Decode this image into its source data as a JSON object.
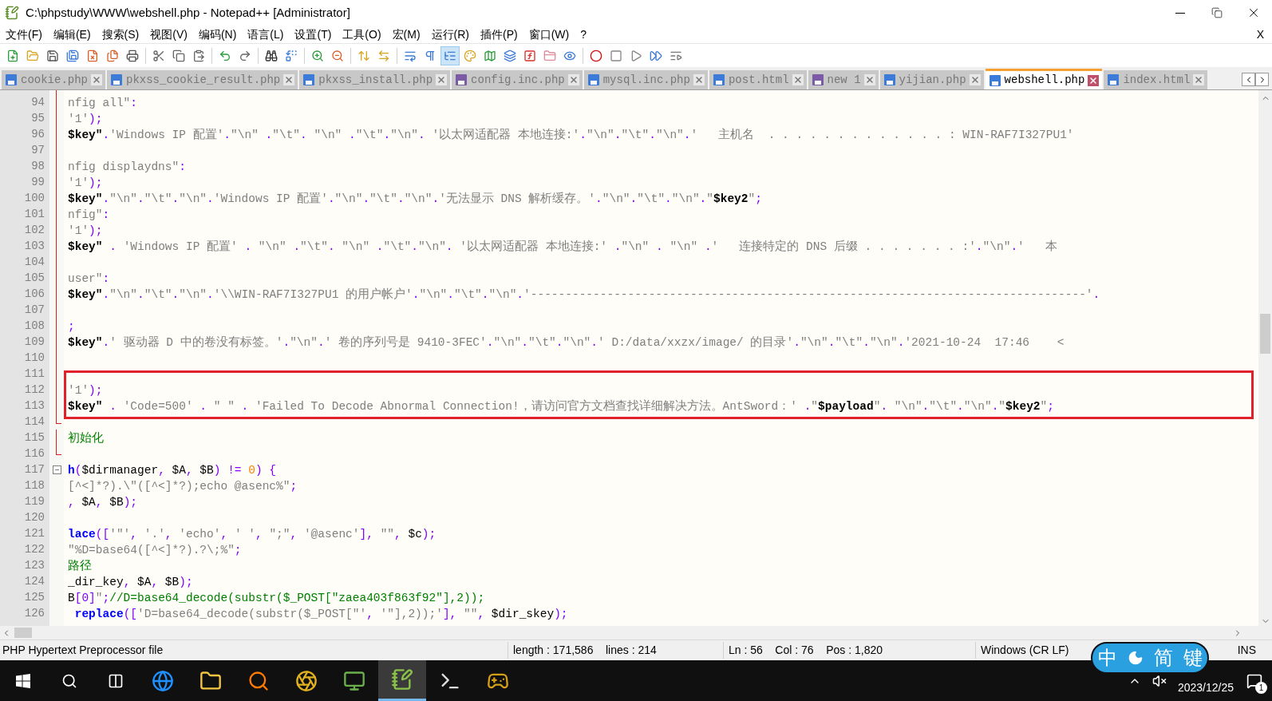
{
  "window": {
    "title": "C:\\phpstudy\\WWW\\webshell.php - Notepad++ [Administrator]"
  },
  "menu": [
    "文件(F)",
    "编辑(E)",
    "搜索(S)",
    "视图(V)",
    "编码(N)",
    "语言(L)",
    "设置(T)",
    "工具(O)",
    "宏(M)",
    "运行(R)",
    "插件(P)",
    "窗口(W)",
    "?"
  ],
  "menu_close": "X",
  "toolbar": [
    {
      "pressed": false
    },
    {
      "pressed": false
    },
    {
      "pressed": false
    },
    {
      "pressed": false
    },
    {
      "pressed": false
    },
    {
      "pressed": false
    },
    {
      "pressed": false
    },
    {
      "pressed": false
    },
    {
      "pressed": false
    },
    {
      "pressed": false
    },
    {
      "pressed": false
    },
    {
      "pressed": false
    },
    {
      "pressed": false
    },
    {
      "pressed": false
    },
    {
      "pressed": false
    },
    {
      "pressed": false
    },
    {
      "pressed": false
    },
    {
      "pressed": false
    },
    {
      "pressed": false
    },
    {
      "pressed": false
    },
    {
      "pressed": true
    },
    {
      "pressed": false
    },
    {
      "pressed": false
    },
    {
      "pressed": false
    },
    {
      "pressed": false
    },
    {
      "pressed": false
    },
    {
      "pressed": false
    },
    {
      "pressed": false
    },
    {
      "pressed": false
    },
    {
      "pressed": false
    },
    {
      "pressed": false
    },
    {
      "pressed": false
    }
  ],
  "tabs": [
    {
      "label": "cookie.php",
      "selected": false,
      "color": "#3d7bd9"
    },
    {
      "label": "pkxss_cookie_result.php",
      "selected": false,
      "color": "#3d7bd9"
    },
    {
      "label": "pkxss_install.php",
      "selected": false,
      "color": "#3d7bd9"
    },
    {
      "label": "config.inc.php",
      "selected": false,
      "color": "#7b5aa6"
    },
    {
      "label": "mysql.inc.php",
      "selected": false,
      "color": "#3d7bd9"
    },
    {
      "label": "post.html",
      "selected": false,
      "color": "#3d7bd9"
    },
    {
      "label": "new 1",
      "selected": false,
      "color": "#7b5aa6"
    },
    {
      "label": "yijian.php",
      "selected": false,
      "color": "#3d7bd9"
    },
    {
      "label": "webshell.php",
      "selected": true,
      "color": "#3d7bd9"
    },
    {
      "label": "index.html",
      "selected": false,
      "color": "#3d7bd9"
    }
  ],
  "editor": {
    "lines": [
      {
        "no": "94",
        "tokens": [
          {
            "kind": "str",
            "text": "nfig all\""
          },
          {
            "kind": "op",
            "text": ":"
          }
        ]
      },
      {
        "no": "95",
        "tokens": [
          {
            "kind": "str",
            "text": "'1'"
          },
          {
            "kind": "op",
            "text": ");"
          }
        ]
      },
      {
        "no": "96",
        "tokens": [
          {
            "kind": "var",
            "text": "$key\""
          },
          {
            "kind": "op",
            "text": "."
          },
          {
            "kind": "str",
            "text": "'Windows IP 配置'"
          },
          {
            "kind": "op",
            "text": "."
          },
          {
            "kind": "str",
            "text": "\"\\n\" "
          },
          {
            "kind": "op",
            "text": "."
          },
          {
            "kind": "str",
            "text": "\"\\t\""
          },
          {
            "kind": "op",
            "text": ". "
          },
          {
            "kind": "str",
            "text": "\"\\n\" "
          },
          {
            "kind": "op",
            "text": "."
          },
          {
            "kind": "str",
            "text": "\"\\t\""
          },
          {
            "kind": "op",
            "text": "."
          },
          {
            "kind": "str",
            "text": "\"\\n\""
          },
          {
            "kind": "op",
            "text": ". "
          },
          {
            "kind": "str",
            "text": "'以太网适配器 本地连接:'"
          },
          {
            "kind": "op",
            "text": "."
          },
          {
            "kind": "str",
            "text": "\"\\n\""
          },
          {
            "kind": "op",
            "text": "."
          },
          {
            "kind": "str",
            "text": "\"\\t\""
          },
          {
            "kind": "op",
            "text": "."
          },
          {
            "kind": "str",
            "text": "\"\\n\""
          },
          {
            "kind": "op",
            "text": "."
          },
          {
            "kind": "str",
            "text": "'   主机名  . . . . . . . . . . . . . : WIN-RAF7I327PU1'"
          }
        ]
      },
      {
        "no": "97"
      },
      {
        "no": "98",
        "tokens": [
          {
            "kind": "str",
            "text": "nfig displaydns\""
          },
          {
            "kind": "op",
            "text": ":"
          }
        ]
      },
      {
        "no": "99",
        "tokens": [
          {
            "kind": "str",
            "text": "'1'"
          },
          {
            "kind": "op",
            "text": ");"
          }
        ]
      },
      {
        "no": "100",
        "tokens": [
          {
            "kind": "var",
            "text": "$key\""
          },
          {
            "kind": "op",
            "text": "."
          },
          {
            "kind": "str",
            "text": "\"\\n\""
          },
          {
            "kind": "op",
            "text": "."
          },
          {
            "kind": "str",
            "text": "\"\\t\""
          },
          {
            "kind": "op",
            "text": "."
          },
          {
            "kind": "str",
            "text": "\"\\n\""
          },
          {
            "kind": "op",
            "text": "."
          },
          {
            "kind": "str",
            "text": "'Windows IP 配置'"
          },
          {
            "kind": "op",
            "text": "."
          },
          {
            "kind": "str",
            "text": "\"\\n\""
          },
          {
            "kind": "op",
            "text": "."
          },
          {
            "kind": "str",
            "text": "\"\\t\""
          },
          {
            "kind": "op",
            "text": "."
          },
          {
            "kind": "str",
            "text": "\"\\n\""
          },
          {
            "kind": "op",
            "text": "."
          },
          {
            "kind": "str",
            "text": "'无法显示 DNS 解析缓存。'"
          },
          {
            "kind": "op",
            "text": "."
          },
          {
            "kind": "str",
            "text": "\"\\n\""
          },
          {
            "kind": "op",
            "text": "."
          },
          {
            "kind": "str",
            "text": "\"\\t\""
          },
          {
            "kind": "op",
            "text": "."
          },
          {
            "kind": "str",
            "text": "\"\\n\""
          },
          {
            "kind": "op",
            "text": "."
          },
          {
            "kind": "str",
            "text": "\""
          },
          {
            "kind": "var",
            "text": "$key2"
          },
          {
            "kind": "str",
            "text": "\""
          },
          {
            "kind": "op",
            "text": ";"
          }
        ]
      },
      {
        "no": "101",
        "tokens": [
          {
            "kind": "str",
            "text": "nfig\""
          },
          {
            "kind": "op",
            "text": ":"
          }
        ]
      },
      {
        "no": "102",
        "tokens": [
          {
            "kind": "str",
            "text": "'1'"
          },
          {
            "kind": "op",
            "text": ");"
          }
        ]
      },
      {
        "no": "103",
        "tokens": [
          {
            "kind": "var",
            "text": "$key\""
          },
          {
            "kind": "op",
            "text": " . "
          },
          {
            "kind": "str",
            "text": "'Windows IP 配置'"
          },
          {
            "kind": "op",
            "text": " . "
          },
          {
            "kind": "str",
            "text": "\"\\n\" "
          },
          {
            "kind": "op",
            "text": "."
          },
          {
            "kind": "str",
            "text": "\"\\t\""
          },
          {
            "kind": "op",
            "text": ". "
          },
          {
            "kind": "str",
            "text": "\"\\n\" "
          },
          {
            "kind": "op",
            "text": "."
          },
          {
            "kind": "str",
            "text": "\"\\t\""
          },
          {
            "kind": "op",
            "text": "."
          },
          {
            "kind": "str",
            "text": "\"\\n\""
          },
          {
            "kind": "op",
            "text": ". "
          },
          {
            "kind": "str",
            "text": "'以太网适配器 本地连接:'"
          },
          {
            "kind": "op",
            "text": " ."
          },
          {
            "kind": "str",
            "text": "\"\\n\" "
          },
          {
            "kind": "op",
            "text": ". "
          },
          {
            "kind": "str",
            "text": "\"\\n\" "
          },
          {
            "kind": "op",
            "text": "."
          },
          {
            "kind": "str",
            "text": "'   连接特定的 DNS 后缀 . . . . . . . :'"
          },
          {
            "kind": "op",
            "text": "."
          },
          {
            "kind": "str",
            "text": "\"\\n\""
          },
          {
            "kind": "op",
            "text": "."
          },
          {
            "kind": "str",
            "text": "'   本"
          }
        ]
      },
      {
        "no": "104"
      },
      {
        "no": "105",
        "tokens": [
          {
            "kind": "str",
            "text": "user\""
          },
          {
            "kind": "op",
            "text": ":"
          }
        ]
      },
      {
        "no": "106",
        "tokens": [
          {
            "kind": "var",
            "text": "$key\""
          },
          {
            "kind": "op",
            "text": "."
          },
          {
            "kind": "str",
            "text": "\"\\n\""
          },
          {
            "kind": "op",
            "text": "."
          },
          {
            "kind": "str",
            "text": "\"\\t\""
          },
          {
            "kind": "op",
            "text": "."
          },
          {
            "kind": "str",
            "text": "\"\\n\""
          },
          {
            "kind": "op",
            "text": "."
          },
          {
            "kind": "str",
            "text": "'\\\\WIN-RAF7I327PU1 的用户帐户'"
          },
          {
            "kind": "op",
            "text": "."
          },
          {
            "kind": "str",
            "text": "\"\\n\""
          },
          {
            "kind": "op",
            "text": "."
          },
          {
            "kind": "str",
            "text": "\"\\t\""
          },
          {
            "kind": "op",
            "text": "."
          },
          {
            "kind": "str",
            "text": "\"\\n\""
          },
          {
            "kind": "op",
            "text": "."
          },
          {
            "kind": "str",
            "text": "'--------------------------------------------------------------------------------'"
          },
          {
            "kind": "op",
            "text": "."
          }
        ]
      },
      {
        "no": "107"
      },
      {
        "no": "108",
        "tokens": [
          {
            "kind": "op",
            "text": ";"
          }
        ]
      },
      {
        "no": "109",
        "tokens": [
          {
            "kind": "var",
            "text": "$key\""
          },
          {
            "kind": "op",
            "text": "."
          },
          {
            "kind": "str",
            "text": "' 驱动器 D 中的卷没有标签。'"
          },
          {
            "kind": "op",
            "text": "."
          },
          {
            "kind": "str",
            "text": "\"\\n\""
          },
          {
            "kind": "op",
            "text": "."
          },
          {
            "kind": "str",
            "text": "' 卷的序列号是 9410-3FEC'"
          },
          {
            "kind": "op",
            "text": "."
          },
          {
            "kind": "str",
            "text": "\"\\n\""
          },
          {
            "kind": "op",
            "text": "."
          },
          {
            "kind": "str",
            "text": "\"\\t\""
          },
          {
            "kind": "op",
            "text": "."
          },
          {
            "kind": "str",
            "text": "\"\\n\""
          },
          {
            "kind": "op",
            "text": "."
          },
          {
            "kind": "str",
            "text": "' D:/data/xxzx/image/ 的目录'"
          },
          {
            "kind": "op",
            "text": "."
          },
          {
            "kind": "str",
            "text": "\"\\n\""
          },
          {
            "kind": "op",
            "text": "."
          },
          {
            "kind": "str",
            "text": "\"\\t\""
          },
          {
            "kind": "op",
            "text": "."
          },
          {
            "kind": "str",
            "text": "\"\\n\""
          },
          {
            "kind": "op",
            "text": "."
          },
          {
            "kind": "str",
            "text": "'2021-10-24  17:46    <"
          }
        ]
      },
      {
        "no": "110"
      },
      {
        "no": "111"
      },
      {
        "no": "112",
        "tokens": [
          {
            "kind": "str",
            "text": "'1'"
          },
          {
            "kind": "op",
            "text": ");"
          }
        ]
      },
      {
        "no": "113",
        "tokens": [
          {
            "kind": "var",
            "text": "$key\""
          },
          {
            "kind": "op",
            "text": " . "
          },
          {
            "kind": "str",
            "text": "'Code=500'"
          },
          {
            "kind": "op",
            "text": " . "
          },
          {
            "kind": "str",
            "text": "\" \""
          },
          {
            "kind": "op",
            "text": " . "
          },
          {
            "kind": "str",
            "text": "'Failed To Decode Abnormal Connection!，请访问官方文档查找详细解决方法。AntSword：' "
          },
          {
            "kind": "op",
            "text": "."
          },
          {
            "kind": "str",
            "text": "\""
          },
          {
            "kind": "var",
            "text": "$payload"
          },
          {
            "kind": "str",
            "text": "\""
          },
          {
            "kind": "op",
            "text": ". "
          },
          {
            "kind": "str",
            "text": "\"\\n\""
          },
          {
            "kind": "op",
            "text": "."
          },
          {
            "kind": "str",
            "text": "\"\\t\""
          },
          {
            "kind": "op",
            "text": "."
          },
          {
            "kind": "str",
            "text": "\"\\n\""
          },
          {
            "kind": "op",
            "text": "."
          },
          {
            "kind": "str",
            "text": "\""
          },
          {
            "kind": "var",
            "text": "$key2"
          },
          {
            "kind": "str",
            "text": "\""
          },
          {
            "kind": "op",
            "text": ";"
          }
        ]
      },
      {
        "no": "114"
      },
      {
        "no": "115",
        "tokens": [
          {
            "kind": "cmt",
            "text": "初始化"
          }
        ]
      },
      {
        "no": "116"
      },
      {
        "no": "117",
        "fold": true,
        "tokens": [
          {
            "kind": "fn",
            "text": "h"
          },
          {
            "kind": "op",
            "text": "("
          },
          {
            "kind": "plain",
            "text": "$dirmanager"
          },
          {
            "kind": "op",
            "text": ", "
          },
          {
            "kind": "plain",
            "text": "$A"
          },
          {
            "kind": "op",
            "text": ", "
          },
          {
            "kind": "plain",
            "text": "$B"
          },
          {
            "kind": "op",
            "text": ") != "
          },
          {
            "kind": "num",
            "text": "0"
          },
          {
            "kind": "op",
            "text": ") {"
          }
        ]
      },
      {
        "no": "118",
        "tokens": [
          {
            "kind": "str",
            "text": "[^<]*?).\\\"([^<]*?);echo @asenc%\""
          },
          {
            "kind": "op",
            "text": ";"
          }
        ]
      },
      {
        "no": "119",
        "tokens": [
          {
            "kind": "op",
            "text": ", "
          },
          {
            "kind": "plain",
            "text": "$A"
          },
          {
            "kind": "op",
            "text": ", "
          },
          {
            "kind": "plain",
            "text": "$B"
          },
          {
            "kind": "op",
            "text": ");"
          }
        ]
      },
      {
        "no": "120"
      },
      {
        "no": "121",
        "tokens": [
          {
            "kind": "fn",
            "text": "lace"
          },
          {
            "kind": "op",
            "text": "(["
          },
          {
            "kind": "str",
            "text": "'\"'"
          },
          {
            "kind": "op",
            "text": ", "
          },
          {
            "kind": "str",
            "text": "'.'"
          },
          {
            "kind": "op",
            "text": ", "
          },
          {
            "kind": "str",
            "text": "'echo'"
          },
          {
            "kind": "op",
            "text": ", "
          },
          {
            "kind": "str",
            "text": "' '"
          },
          {
            "kind": "op",
            "text": ", "
          },
          {
            "kind": "str",
            "text": "\";\""
          },
          {
            "kind": "op",
            "text": ", "
          },
          {
            "kind": "str",
            "text": "'@asenc'"
          },
          {
            "kind": "op",
            "text": "], "
          },
          {
            "kind": "str",
            "text": "\"\""
          },
          {
            "kind": "op",
            "text": ", "
          },
          {
            "kind": "plain",
            "text": "$c"
          },
          {
            "kind": "op",
            "text": ");"
          }
        ]
      },
      {
        "no": "122",
        "tokens": [
          {
            "kind": "str",
            "text": "\"%D=base64([^<]*?).?\\;%\""
          },
          {
            "kind": "op",
            "text": ";"
          }
        ]
      },
      {
        "no": "123",
        "tokens": [
          {
            "kind": "cmt",
            "text": "路径"
          }
        ]
      },
      {
        "no": "124",
        "tokens": [
          {
            "kind": "plain",
            "text": "_dir_key"
          },
          {
            "kind": "op",
            "text": ", "
          },
          {
            "kind": "plain",
            "text": "$A"
          },
          {
            "kind": "op",
            "text": ", "
          },
          {
            "kind": "plain",
            "text": "$B"
          },
          {
            "kind": "op",
            "text": ");"
          }
        ]
      },
      {
        "no": "125",
        "tokens": [
          {
            "kind": "plain",
            "text": "B"
          },
          {
            "kind": "op",
            "text": "[0]"
          },
          {
            "kind": "str",
            "text": "\""
          },
          {
            "kind": "op",
            "text": ";"
          },
          {
            "kind": "cmt",
            "text": "//D=base64_decode(substr($_POST[\"zaea403f863f92\"],2));"
          }
        ]
      },
      {
        "no": "126",
        "tokens": [
          {
            "kind": "fn",
            "text": " replace"
          },
          {
            "kind": "op",
            "text": "(["
          },
          {
            "kind": "str",
            "text": "'D=base64_decode(substr($_POST[\"'"
          },
          {
            "kind": "op",
            "text": ", "
          },
          {
            "kind": "str",
            "text": "'\"],2));'"
          },
          {
            "kind": "op",
            "text": "], "
          },
          {
            "kind": "str",
            "text": "\"\""
          },
          {
            "kind": "op",
            "text": ", "
          },
          {
            "kind": "plain",
            "text": "$dir_skey"
          },
          {
            "kind": "op",
            "text": ");"
          }
        ]
      }
    ]
  },
  "status_bar": {
    "file_type": "PHP Hypertext Preprocessor file",
    "length": "length : 171,586    lines : 214",
    "position": "Ln : 56    Col : 76    Pos : 1,820",
    "eol": "Windows (CR LF)",
    "mode": "INS"
  },
  "ime_bar": [
    "中",
    "简",
    "键"
  ],
  "taskbar": {
    "apps": [
      {
        "active": false
      },
      {
        "active": false
      },
      {
        "active": false
      },
      {
        "active": false
      },
      {
        "active": false
      },
      {
        "active": true
      },
      {
        "active": false
      },
      {
        "active": false
      }
    ],
    "date": "2023/12/25",
    "notifications": "1"
  }
}
